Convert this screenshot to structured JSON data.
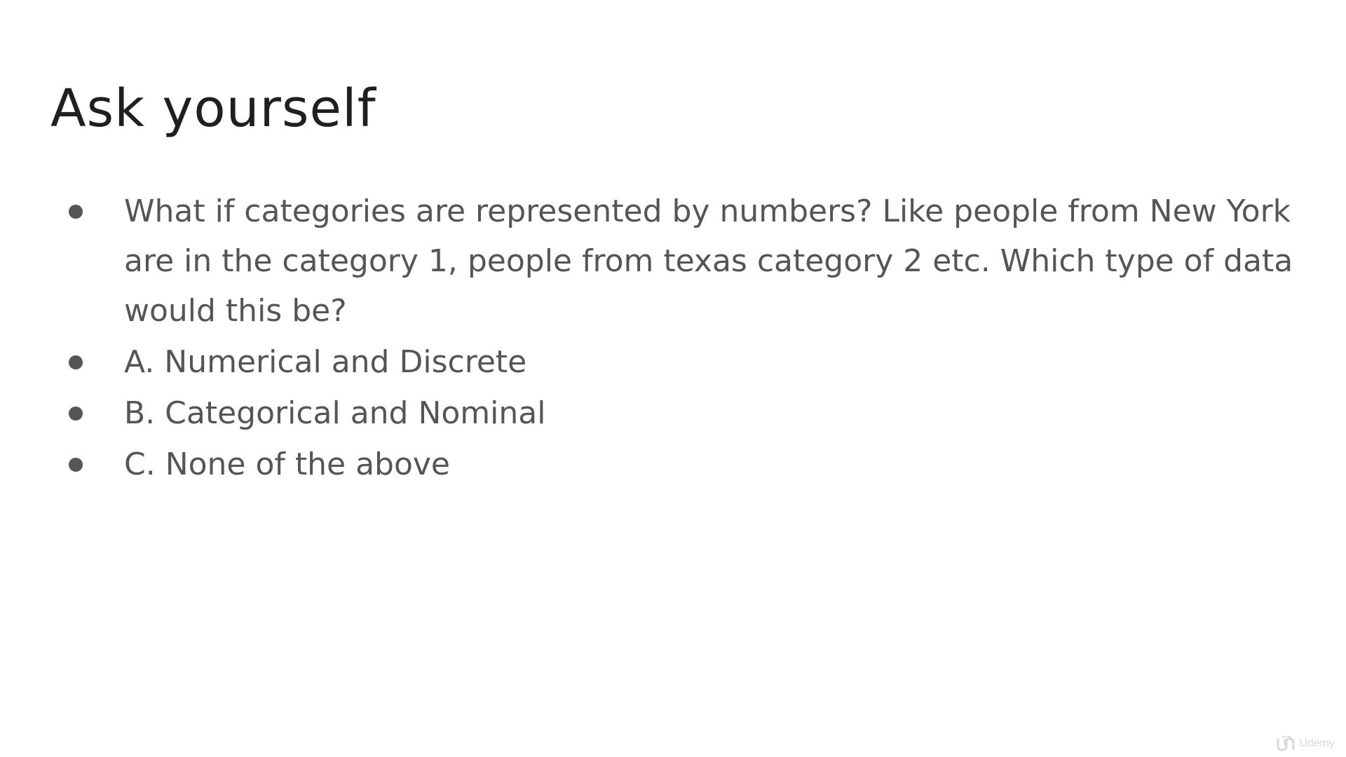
{
  "slide": {
    "title": "Ask yourself",
    "bullets": [
      {
        "text": "What if categories are represented by numbers? Like people from New York are in the category 1, people from texas category 2 etc. Which type of data would this be?"
      },
      {
        "text": "A. Numerical and Discrete"
      },
      {
        "text": "B. Categorical and Nominal"
      },
      {
        "text": "C. None of the above"
      }
    ]
  },
  "watermark": {
    "brand": "Udemy",
    "icon": "udemy-logo-icon"
  },
  "colors": {
    "title": "#1f1f1f",
    "body_text": "#555555",
    "background": "#ffffff",
    "watermark": "#d8d8d8"
  }
}
